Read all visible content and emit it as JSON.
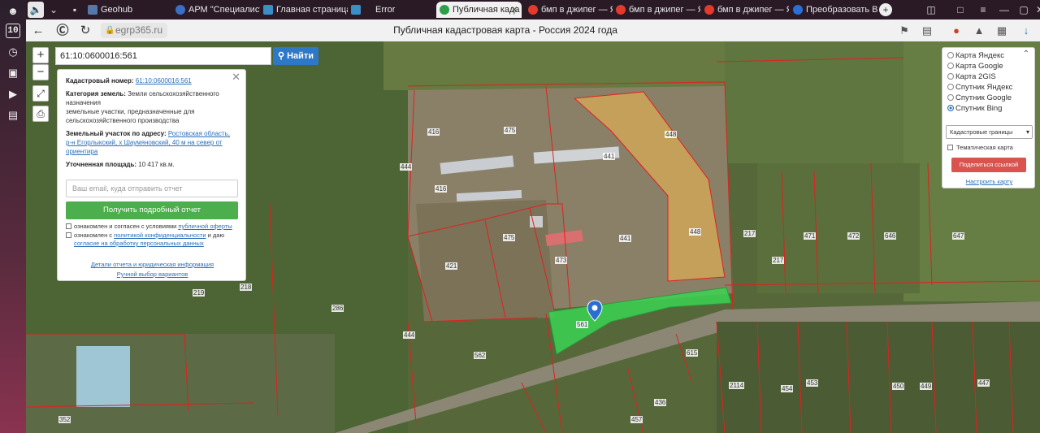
{
  "browser": {
    "tabs": [
      {
        "label": "",
        "icon": "speaker-icon",
        "active": false
      },
      {
        "label": "Geohub",
        "active": false,
        "color": "#5577aa"
      },
      {
        "label": "АРМ \"Специалист\"",
        "active": false,
        "color": "#3a6fc4"
      },
      {
        "label": "Главная страница",
        "active": false,
        "color": "#3a8fc8"
      },
      {
        "label": "Error",
        "active": false,
        "color": "#3a8fc8"
      },
      {
        "label": "Публичная када",
        "active": true,
        "color": "#2e9e4a"
      },
      {
        "label": "бмп в джипег — Ян",
        "active": false,
        "color": "#e23b2e"
      },
      {
        "label": "бмп в джипег — Ян",
        "active": false,
        "color": "#e23b2e"
      },
      {
        "label": "бмп в джипег — Ян",
        "active": false,
        "color": "#e23b2e"
      },
      {
        "label": "Преобразовать BM",
        "active": false,
        "color": "#2a6fd8"
      }
    ],
    "url": "egrp365.ru",
    "page_title": "Публичная кадастровая карта - Россия 2024 года",
    "sidebar_badge": "10"
  },
  "search": {
    "value": "61:10:0600016:561",
    "button": "Найти"
  },
  "info": {
    "cad_label": "Кадастровый номер:",
    "cad_value": "61:10:0600016:561",
    "cat_label": "Категория земель:",
    "cat_value": "Земли сельскохозяйственного назначения",
    "cat_sub": "земельные участки, предназначенные для сельскохозяйственного производства",
    "addr_label": "Земельный участок по адресу:",
    "addr_value": "Ростовская область, р-н Егорлыкский, х Шаумяновский, 40 м на север от ориентира",
    "area_label": "Уточненная площадь:",
    "area_value": "10 417 кв.м.",
    "email_placeholder": "Ваш email, куда отправить отчет",
    "report_button": "Получить подробный отчет",
    "check1_pre": "ознакомлен и согласен с условиями ",
    "check1_link": "публичной оферты",
    "check2_pre": "ознакомлен с ",
    "check2_link": "политикой конфиденциальности",
    "check2_mid": " и даю",
    "check2_link2": "согласие на обработку персональных данных",
    "details_link": "Детали отчета и юридическая информация",
    "manual_link": "Ручной выбор вариантов"
  },
  "layers": {
    "options": [
      {
        "label": "Карта Яндекс",
        "selected": false
      },
      {
        "label": "Карта Google",
        "selected": false
      },
      {
        "label": "Карта 2GIS",
        "selected": false
      },
      {
        "label": "Спутник Яндекс",
        "selected": false
      },
      {
        "label": "Спутник Google",
        "selected": false
      },
      {
        "label": "Спутник Bing",
        "selected": true
      }
    ],
    "select_value": "Кадастровые границы",
    "thematic": "Тематическая карта",
    "share": "Поделиться ссылкой",
    "configure": "Настроить карту"
  },
  "map": {
    "parcel_labels": [
      "416",
      "475",
      "441",
      "448",
      "444",
      "416",
      "475",
      "421",
      "473",
      "441",
      "448",
      "217",
      "471",
      "472",
      "646",
      "647",
      "217",
      "218",
      "219",
      "286",
      "444",
      "562",
      "561",
      "615",
      "2114",
      "457",
      "454",
      "453",
      "450",
      "449",
      "447",
      "436",
      "457",
      "352"
    ]
  },
  "colors": {
    "accent": "#2e78c8",
    "green_button": "#4cae4c",
    "red_button": "#d9534f",
    "parcel_highlight": "#39d353",
    "cadastre_line": "#e02020"
  }
}
